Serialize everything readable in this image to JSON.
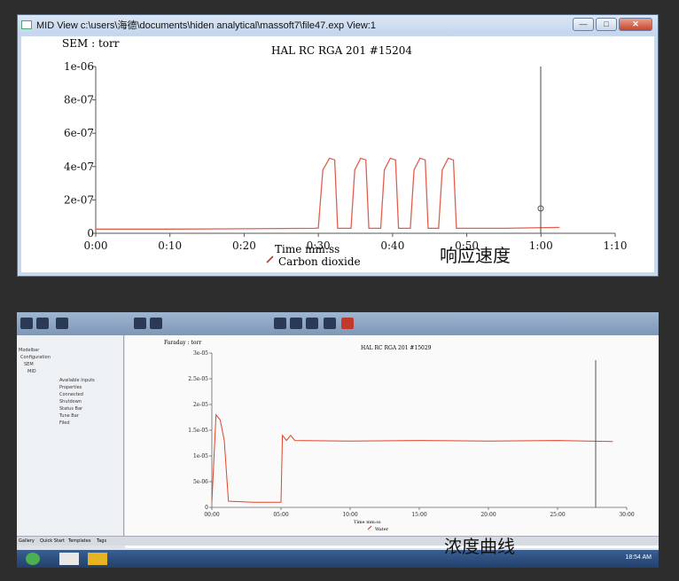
{
  "top_window": {
    "title": "MID View   c:\\users\\海德\\documents\\hiden analytical\\massoft7\\file47.exp View:1",
    "min_label": "—",
    "max_label": "□",
    "close_label": "✕",
    "chart_title": "HAL RC RGA 201 #15204",
    "y_unit_label": "SEM : torr",
    "x_axis_label": "Time  mm:ss",
    "legend_label": "Carbon dioxide",
    "caption": "响应速度",
    "y_ticks": [
      "1e-06",
      "8e-07",
      "6e-07",
      "4e-07",
      "2e-07",
      "0"
    ],
    "x_ticks": [
      "0:00",
      "0:10",
      "0:20",
      "0:30",
      "0:40",
      "0:50",
      "1:00",
      "1:10"
    ],
    "series_color": "#e06050"
  },
  "bottom_photo": {
    "chart_title": "HAL RC RGA 201 #15029",
    "y_unit_label": "Faraday : torr",
    "x_axis_label": "Time  mm:ss",
    "legend_label": "Water",
    "caption": "浓度曲线",
    "y_ticks": [
      "3e-05",
      "2.5e-05",
      "2e-05",
      "1.5e-05",
      "1e-05",
      "5e-06",
      "0"
    ],
    "x_ticks": [
      "00:00",
      "05:00",
      "10:00",
      "15:00",
      "20:00",
      "25:00",
      "30:00"
    ],
    "tree_items": [
      "Modelbar",
      "Configuration",
      "SEM",
      "MID",
      "Available Inputs",
      "Properties",
      "Connected",
      "Shutdown",
      "Status Bar",
      "Tune Bar",
      "Filed"
    ],
    "status_tabs": [
      "Gallery",
      "Quick Start",
      "Templates",
      "Tags"
    ],
    "tray_time": "18:54 AM",
    "series_color": "#e0442a"
  },
  "chart_data": [
    {
      "type": "line",
      "title": "HAL RC RGA 201 #15204",
      "xlabel": "Time  mm:ss",
      "ylabel": "SEM : torr",
      "x_range_seconds": [
        0,
        70
      ],
      "ylim": [
        0,
        1e-06
      ],
      "series": [
        {
          "name": "Carbon dioxide",
          "points": [
            [
              0,
              2.5e-08
            ],
            [
              10,
              2.5e-08
            ],
            [
              20,
              2.7e-08
            ],
            [
              29.5,
              3e-08
            ],
            [
              30,
              3.2e-08
            ],
            [
              30.6,
              3.8e-07
            ],
            [
              31.5,
              4.5e-07
            ],
            [
              32.2,
              4.4e-07
            ],
            [
              32.6,
              3e-08
            ],
            [
              34.4,
              3e-08
            ],
            [
              34.9,
              3.8e-07
            ],
            [
              35.7,
              4.5e-07
            ],
            [
              36.4,
              4.4e-07
            ],
            [
              36.8,
              3e-08
            ],
            [
              38.4,
              3e-08
            ],
            [
              38.9,
              3.8e-07
            ],
            [
              39.7,
              4.5e-07
            ],
            [
              40.4,
              4.4e-07
            ],
            [
              40.8,
              3e-08
            ],
            [
              42.4,
              3e-08
            ],
            [
              42.9,
              3.8e-07
            ],
            [
              43.7,
              4.5e-07
            ],
            [
              44.4,
              4.4e-07
            ],
            [
              44.8,
              3e-08
            ],
            [
              46.2,
              3e-08
            ],
            [
              46.7,
              3.8e-07
            ],
            [
              47.5,
              4.5e-07
            ],
            [
              48.2,
              4.4e-07
            ],
            [
              48.6,
              3e-08
            ],
            [
              55,
              3e-08
            ],
            [
              62.5,
              3.5e-08
            ]
          ]
        }
      ]
    },
    {
      "type": "line",
      "title": "HAL RC RGA 201 #15029",
      "xlabel": "Time  mm:ss",
      "ylabel": "Faraday : torr",
      "x_range_minutes": [
        0,
        30
      ],
      "ylim": [
        0,
        3e-05
      ],
      "series": [
        {
          "name": "Water",
          "points": [
            [
              0,
              1e-06
            ],
            [
              0.3,
              1.8e-05
            ],
            [
              0.6,
              1.7e-05
            ],
            [
              0.9,
              1.3e-05
            ],
            [
              1.2,
              1.2e-06
            ],
            [
              3,
              1e-06
            ],
            [
              5,
              1e-06
            ],
            [
              5.1,
              1.4e-05
            ],
            [
              5.4,
              1.3e-05
            ],
            [
              5.7,
              1.4e-05
            ],
            [
              6,
              1.3e-05
            ],
            [
              10,
              1.29e-05
            ],
            [
              15,
              1.3e-05
            ],
            [
              20,
              1.29e-05
            ],
            [
              25,
              1.3e-05
            ],
            [
              29,
              1.28e-05
            ]
          ]
        }
      ]
    }
  ]
}
